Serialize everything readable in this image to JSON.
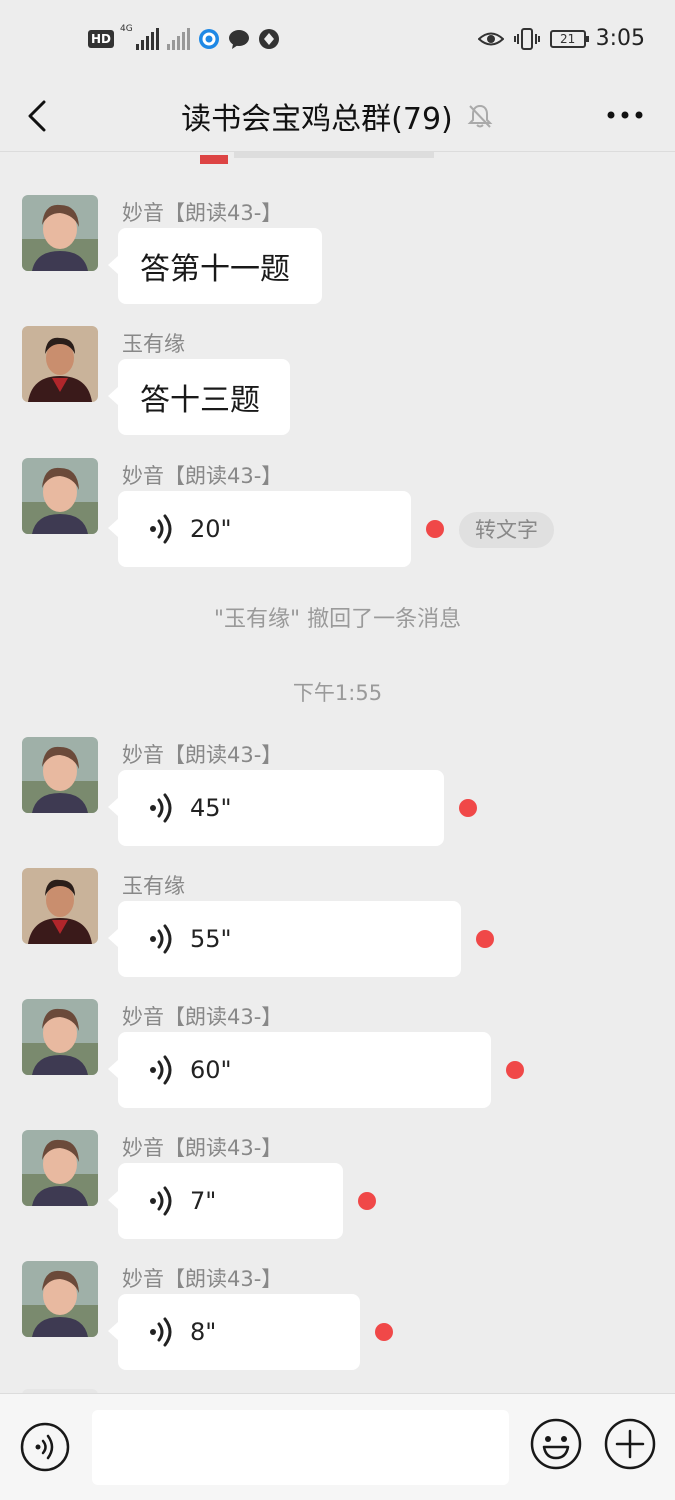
{
  "status_bar": {
    "hd_label": "HD",
    "network_label": "4G",
    "time": "3:05",
    "battery": "21",
    "icons": [
      "hd-icon",
      "signal-icon",
      "signal-no-service-icon",
      "app-notify-icon",
      "chat-notify-icon",
      "vpn-icon",
      "eye-icon",
      "vibrate-icon",
      "battery-icon"
    ]
  },
  "header": {
    "title": "读书会宝鸡总群(79)",
    "back_icon": "chevron-left-icon",
    "mute_icon": "bell-muted-icon",
    "more_icon": "more-dots-icon"
  },
  "messages": [
    {
      "sender": "妙音【朗读43-】",
      "type": "text",
      "text": "答第十一题",
      "avatar": "miaoyin"
    },
    {
      "sender": "玉有缘",
      "type": "text",
      "text": "答十三题",
      "avatar": "yuyouyuan"
    },
    {
      "sender": "妙音【朗读43-】",
      "type": "voice",
      "duration": "20\"",
      "unread": true,
      "to_text": "转文字",
      "avatar": "miaoyin"
    },
    {
      "sender": "妙音【朗读43-】",
      "type": "voice",
      "duration": "45\"",
      "unread": true,
      "avatar": "miaoyin"
    },
    {
      "sender": "玉有缘",
      "type": "voice",
      "duration": "55\"",
      "unread": true,
      "avatar": "yuyouyuan"
    },
    {
      "sender": "妙音【朗读43-】",
      "type": "voice",
      "duration": "60\"",
      "unread": true,
      "avatar": "miaoyin"
    },
    {
      "sender": "妙音【朗读43-】",
      "type": "voice",
      "duration": "7\"",
      "unread": true,
      "avatar": "miaoyin"
    },
    {
      "sender": "妙音【朗读43-】",
      "type": "voice",
      "duration": "8\"",
      "unread": true,
      "avatar": "miaoyin"
    }
  ],
  "system": {
    "recall_notice": "\"玉有缘\" 撤回了一条消息",
    "timestamp": "下午1:55"
  },
  "input_bar": {
    "placeholder": "",
    "voice_icon": "voice-input-icon",
    "emoji_icon": "emoji-icon",
    "plus_icon": "plus-icon"
  },
  "colors": {
    "background": "#ededed",
    "bubble": "#ffffff",
    "unread_dot": "#f04848",
    "sender_text": "#888888"
  }
}
